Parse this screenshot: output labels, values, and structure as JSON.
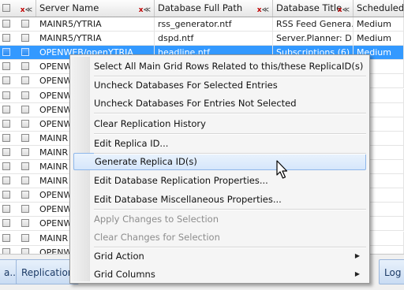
{
  "grid": {
    "columns": [
      {
        "label": "",
        "filter": "x"
      },
      {
        "label": "Server Name",
        "filter": "x"
      },
      {
        "label": "Database Full Path",
        "filter": "x"
      },
      {
        "label": "Database Title",
        "filter": "x"
      },
      {
        "label": "Scheduled A",
        "filter": ""
      }
    ],
    "rows": [
      {
        "server": "MAINR5/YTRIA",
        "path": "rss_generator.ntf",
        "title": "RSS Feed Genera...",
        "sched": "Medium",
        "selected": false
      },
      {
        "server": "MAINR5/YTRIA",
        "path": "dspd.ntf",
        "title": "Server.Planner: D...",
        "sched": "Medium",
        "selected": false
      },
      {
        "server": "OPENWEB/openYTRIA",
        "path": "headline.ntf",
        "title": "Subscriptions (6)",
        "sched": "Medium",
        "selected": true
      },
      {
        "server": "OPENW",
        "path": "",
        "title": "",
        "sched": "",
        "selected": false
      },
      {
        "server": "OPENW",
        "path": "",
        "title": "",
        "sched": "",
        "selected": false
      },
      {
        "server": "OPENW",
        "path": "",
        "title": "",
        "sched": "",
        "selected": false
      },
      {
        "server": "OPENW",
        "path": "",
        "title": "",
        "sched": "",
        "selected": false
      },
      {
        "server": "OPENW",
        "path": "",
        "title": "",
        "sched": "",
        "selected": false
      },
      {
        "server": "MAINR",
        "path": "",
        "title": "",
        "sched": "",
        "selected": false
      },
      {
        "server": "MAINR",
        "path": "",
        "title": "",
        "sched": "",
        "selected": false
      },
      {
        "server": "MAINR",
        "path": "",
        "title": "",
        "sched": "",
        "selected": false
      },
      {
        "server": "MAINR",
        "path": "",
        "title": "",
        "sched": "",
        "selected": false
      },
      {
        "server": "OPENW",
        "path": "",
        "title": "",
        "sched": "",
        "selected": false
      },
      {
        "server": "OPENW",
        "path": "",
        "title": "",
        "sched": "",
        "selected": false
      },
      {
        "server": "OPENW",
        "path": "",
        "title": "",
        "sched": "",
        "selected": false
      },
      {
        "server": "MAINR",
        "path": "",
        "title": "",
        "sched": "",
        "selected": false
      },
      {
        "server": "OPENW",
        "path": "",
        "title": "",
        "sched": "",
        "selected": false
      }
    ]
  },
  "statusbar": {
    "tabs": [
      "a...",
      "Replication",
      "Log A"
    ]
  },
  "context_menu": {
    "items": [
      {
        "label": "Select All Main Grid Rows Related to this/these ReplicaID(s)",
        "disabled": false,
        "highlighted": false,
        "submenu": false
      },
      {
        "label": "Uncheck Databases For Selected Entries",
        "disabled": false,
        "highlighted": false,
        "submenu": false
      },
      {
        "label": "Uncheck Databases For Entries Not Selected",
        "disabled": false,
        "highlighted": false,
        "submenu": false
      },
      {
        "label": "Clear Replication History",
        "disabled": false,
        "highlighted": false,
        "submenu": false
      },
      {
        "label": "Edit Replica ID...",
        "disabled": false,
        "highlighted": false,
        "submenu": false
      },
      {
        "label": "Generate Replica ID(s)",
        "disabled": false,
        "highlighted": true,
        "submenu": false
      },
      {
        "label": "Edit Database Replication Properties...",
        "disabled": false,
        "highlighted": false,
        "submenu": false
      },
      {
        "label": "Edit Database Miscellaneous Properties...",
        "disabled": false,
        "highlighted": false,
        "submenu": false
      },
      {
        "label": "Apply Changes to Selection",
        "disabled": true,
        "highlighted": false,
        "submenu": false
      },
      {
        "label": "Clear Changes for Selection",
        "disabled": true,
        "highlighted": false,
        "submenu": false
      },
      {
        "label": "Grid Action",
        "disabled": false,
        "highlighted": false,
        "submenu": true
      },
      {
        "label": "Grid Columns",
        "disabled": false,
        "highlighted": false,
        "submenu": true
      }
    ]
  },
  "colors": {
    "selection": "#3399ff",
    "menu_highlight": "#d5e6fb"
  }
}
